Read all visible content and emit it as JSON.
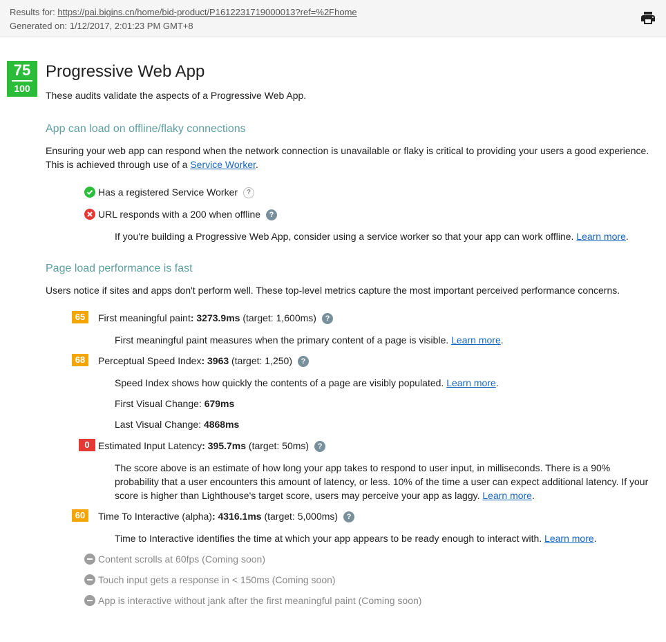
{
  "header": {
    "results_prefix": "Results for:",
    "results_url": "https://pai.bigins.cn/home/bid-product/P1612231719000013?ref=%2Fhome",
    "generated_on": "Generated on: 1/12/2017, 2:01:23 PM GMT+8",
    "print_icon": "print-icon"
  },
  "score": {
    "value": "75",
    "total": "100",
    "color": "#2bbd3a"
  },
  "title": "Progressive Web App",
  "description": "These audits validate the aspects of a Progressive Web App.",
  "offline": {
    "heading": "App can load on offline/flaky connections",
    "desc_prefix": "Ensuring your web app can respond when the network connection is unavailable or flaky is critical to providing your users a good experience. This is achieved through use of a ",
    "desc_link": "Service Worker",
    "desc_suffix": ".",
    "audits": [
      {
        "label": "Has a registered Service Worker",
        "status": "pass"
      },
      {
        "label": "URL responds with a 200 when offline",
        "status": "fail",
        "detail": "If you're building a Progressive Web App, consider using a service worker so that your app can work offline. ",
        "learn_more": "Learn more"
      }
    ]
  },
  "performance": {
    "heading": "Page load performance is fast",
    "desc": "Users notice if sites and apps don't perform well. These top-level metrics capture the most important perceived performance concerns.",
    "fmp": {
      "score": "65",
      "color": "#f4a500",
      "label": "First meaningful paint",
      "value": ": 3273.9ms",
      "target": " (target: 1,600ms)",
      "detail": "First meaningful paint measures when the primary content of a page is visible. ",
      "learn_more": "Learn more"
    },
    "si": {
      "score": "68",
      "color": "#f4a500",
      "label": "Perceptual Speed Index",
      "value": ": 3963",
      "target": " (target: 1,250)",
      "detail": "Speed Index shows how quickly the contents of a page are visibly populated. ",
      "learn_more": "Learn more",
      "first_visual_label": "First Visual Change: ",
      "first_visual_value": "679ms",
      "last_visual_label": "Last Visual Change: ",
      "last_visual_value": "4868ms"
    },
    "eil": {
      "score": "0",
      "color": "#e53935",
      "label": "Estimated Input Latency",
      "value": ": 395.7ms",
      "target": " (target: 50ms)",
      "detail": "The score above is an estimate of how long your app takes to respond to user input, in milliseconds. There is a 90% probability that a user encounters this amount of latency, or less. 10% of the time a user can expect additional latency. If your score is higher than Lighthouse's target score, users may perceive your app as laggy. ",
      "learn_more": "Learn more"
    },
    "tti": {
      "score": "60",
      "color": "#f4a500",
      "label": "Time To Interactive (alpha)",
      "value": ": 4316.1ms",
      "target": " (target: 5,000ms)",
      "detail": "Time to Interactive identifies the time at which your app appears to be ready enough to interact with. ",
      "learn_more": "Learn more"
    },
    "coming_soon": [
      "Content scrolls at 60fps (Coming soon)",
      "Touch input gets a response in < 150ms (Coming soon)",
      "App is interactive without jank after the first meaningful paint (Coming soon)"
    ]
  }
}
